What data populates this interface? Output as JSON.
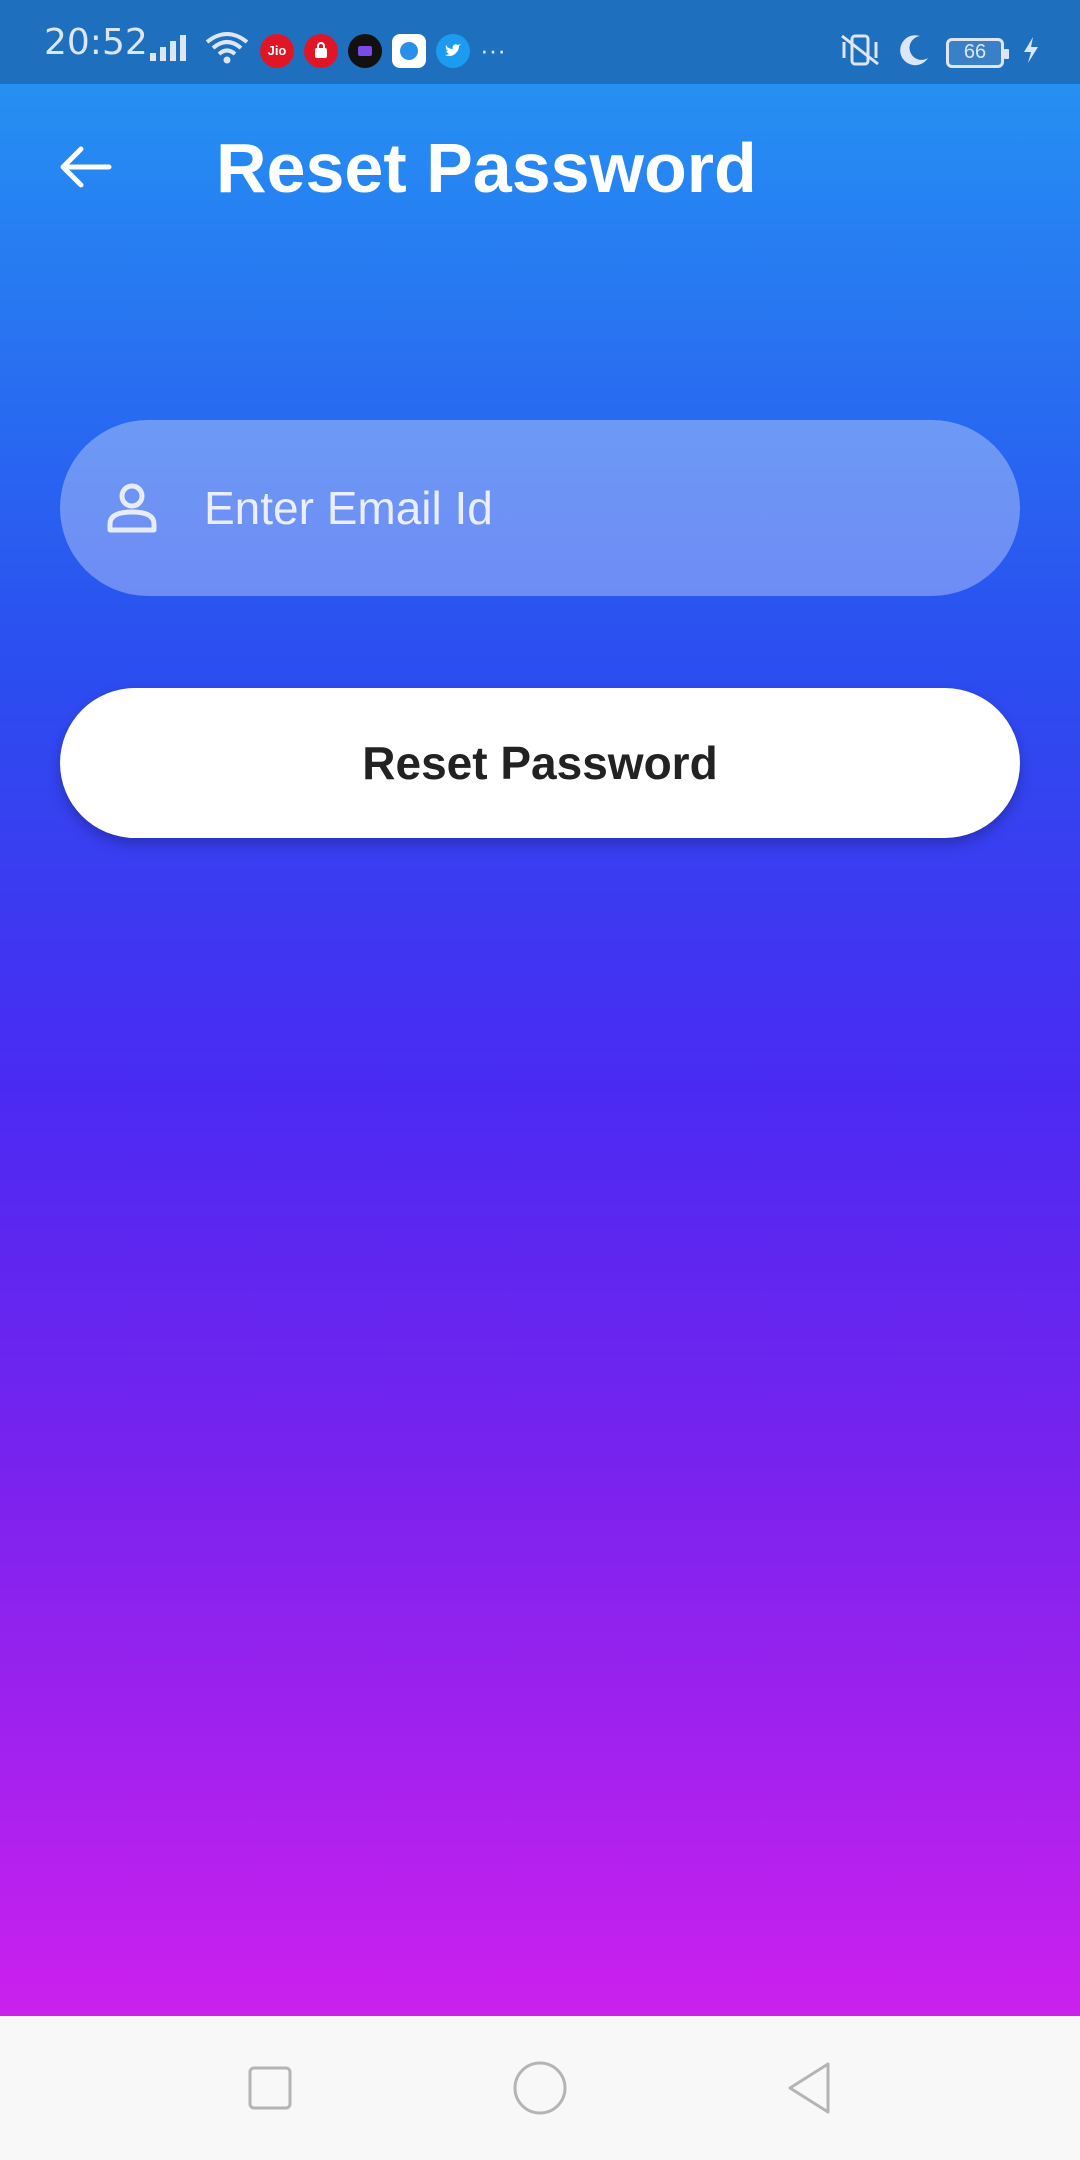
{
  "status_bar": {
    "time": "20:52",
    "battery_level": "66",
    "notification_icons": [
      "jio-icon",
      "shopping-bag-icon",
      "tv-app-icon",
      "browser-icon",
      "twitter-icon"
    ],
    "more_indicator": "···"
  },
  "header": {
    "title": "Reset Password",
    "back_icon": "arrow-left-icon"
  },
  "form": {
    "email_placeholder": "Enter Email Id",
    "email_value": "",
    "email_icon": "person-icon",
    "submit_label": "Reset Password"
  },
  "colors": {
    "gradient_top": "#2590f2",
    "gradient_mid": "#4a2af2",
    "gradient_bottom": "#cc20ee",
    "button_bg": "#ffffff"
  },
  "nav_bar": {
    "buttons": [
      "recents-square-icon",
      "home-circle-icon",
      "back-triangle-icon"
    ]
  }
}
